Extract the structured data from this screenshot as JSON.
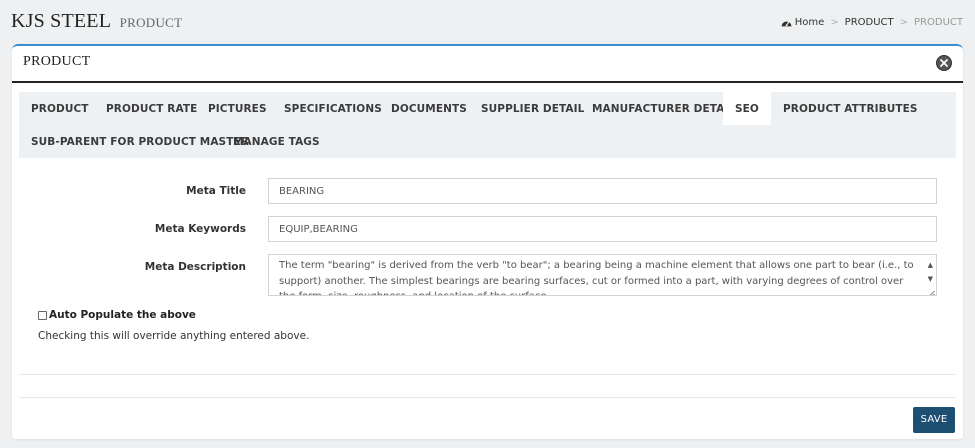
{
  "header": {
    "brand": "KJS STEEL",
    "subtitle": "PRODUCT",
    "breadcrumb": {
      "home_icon": "dashboard-icon",
      "home": "Home",
      "separator": ">",
      "parent": "PRODUCT",
      "current": "PRODUCT"
    }
  },
  "panel": {
    "title": "PRODUCT",
    "close_icon": "close-circle-icon"
  },
  "tabs": [
    {
      "label": "PRODUCT",
      "active": false
    },
    {
      "label": "PRODUCT RATE",
      "active": false
    },
    {
      "label": "PICTURES",
      "active": false
    },
    {
      "label": "SPECIFICATIONS",
      "active": false
    },
    {
      "label": "DOCUMENTS",
      "active": false
    },
    {
      "label": "SUPPLIER DETAIL",
      "active": false
    },
    {
      "label": "MANUFACTURER DETAIL",
      "active": false
    },
    {
      "label": "SEO",
      "active": true
    },
    {
      "label": "PRODUCT ATTRIBUTES",
      "active": false
    },
    {
      "label": "SUB-PARENT FOR PRODUCT MASTER",
      "active": false
    },
    {
      "label": "MANAGE TAGS",
      "active": false
    }
  ],
  "form": {
    "meta_title": {
      "label": "Meta Title",
      "value": "BEARING"
    },
    "meta_keywords": {
      "label": "Meta Keywords",
      "value": "EQUIP,BEARING"
    },
    "meta_description": {
      "label": "Meta Description",
      "value": "The term \"bearing\" is derived from the verb \"to bear\"; a bearing being a machine element that allows one part to bear (i.e., to support) another. The simplest bearings are bearing surfaces, cut or formed into a part, with varying degrees of control over the form, size, roughness, and location of the surface."
    },
    "auto_populate": {
      "label": "Auto Populate the above",
      "checked": false
    },
    "hint": "Checking this will override anything entered above."
  },
  "actions": {
    "save": "SAVE"
  },
  "colors": {
    "accent": "#3a8ed0",
    "save_button": "#1d4f73",
    "tab_bar": "#eef1f4",
    "page_bg": "#eef0f2"
  }
}
